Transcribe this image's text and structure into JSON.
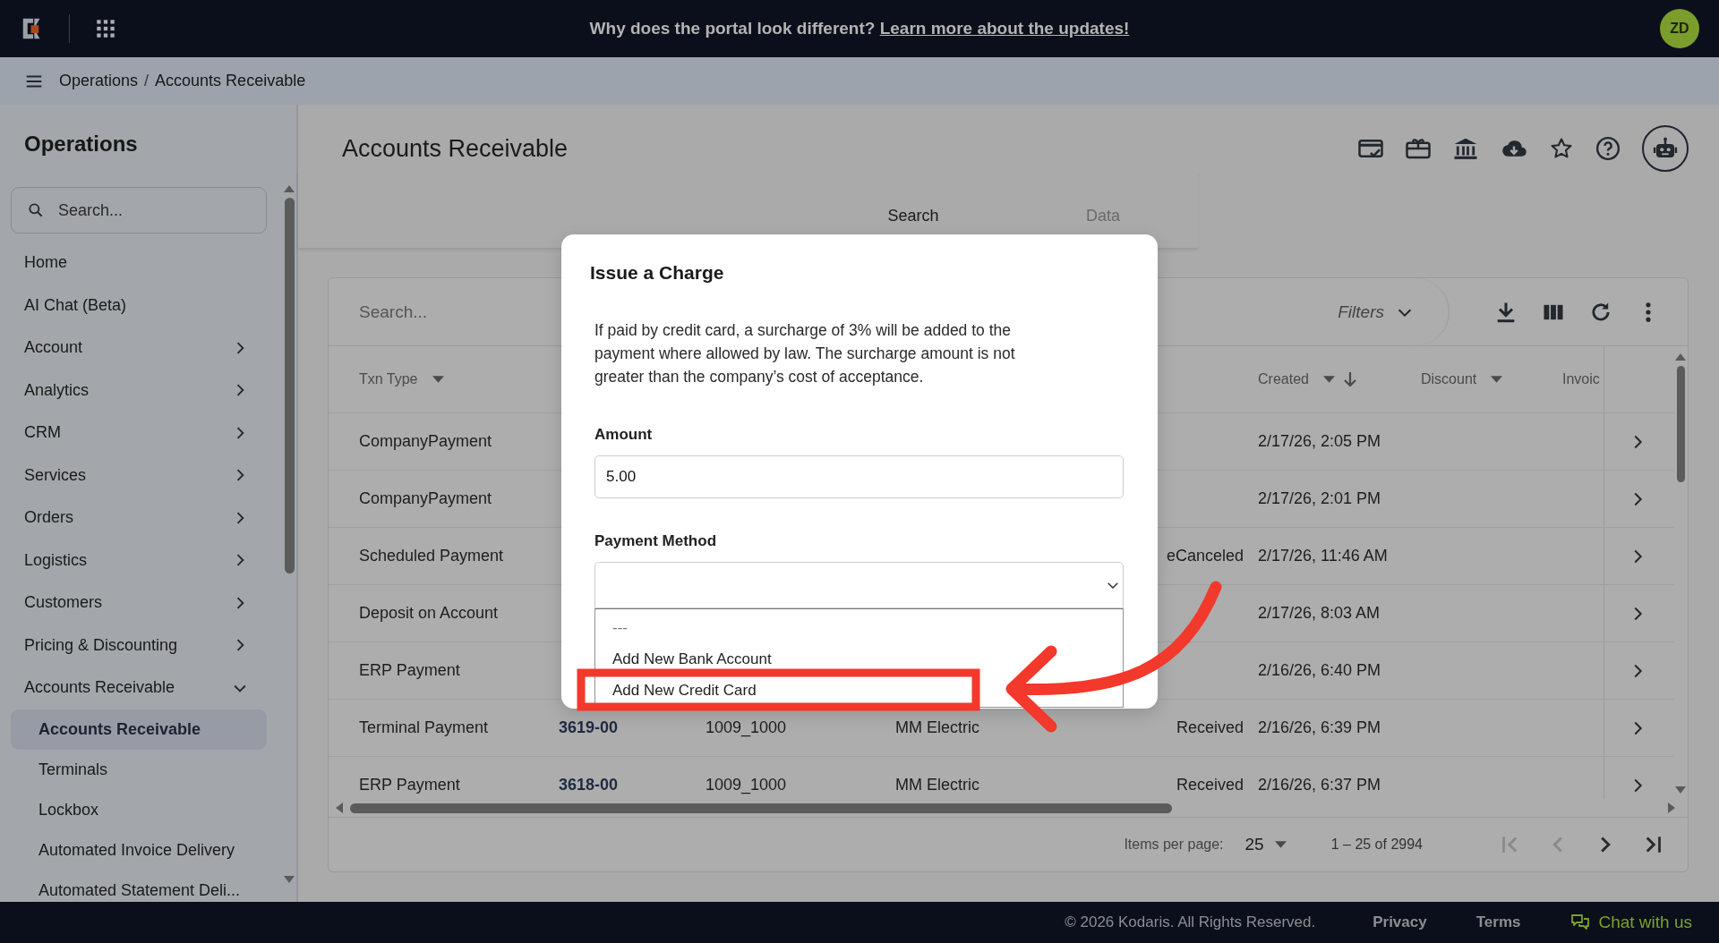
{
  "top_bar": {
    "banner_text": "Why does the portal look different?",
    "banner_link": "Learn more about the updates!",
    "avatar": "ZD"
  },
  "breadcrumb": {
    "items": [
      "Operations",
      "Accounts Receivable"
    ],
    "separator": "/"
  },
  "sidebar": {
    "title": "Operations",
    "search": {
      "placeholder": "Search..."
    },
    "items": [
      {
        "label": "Home",
        "kind": "link"
      },
      {
        "label": "AI Chat (Beta)",
        "kind": "link"
      },
      {
        "label": "Account",
        "kind": "group",
        "expanded": false
      },
      {
        "label": "Analytics",
        "kind": "group",
        "expanded": false
      },
      {
        "label": "CRM",
        "kind": "group",
        "expanded": false
      },
      {
        "label": "Services",
        "kind": "group",
        "expanded": false
      },
      {
        "label": "Orders",
        "kind": "group",
        "expanded": false
      },
      {
        "label": "Logistics",
        "kind": "group",
        "expanded": false
      },
      {
        "label": "Customers",
        "kind": "group",
        "expanded": false
      },
      {
        "label": "Pricing & Discounting",
        "kind": "group",
        "expanded": false
      },
      {
        "label": "Accounts Receivable",
        "kind": "group",
        "expanded": true,
        "children": [
          {
            "label": "Accounts Receivable",
            "selected": true
          },
          {
            "label": "Terminals",
            "selected": false
          },
          {
            "label": "Lockbox",
            "selected": false
          },
          {
            "label": "Automated Invoice Delivery",
            "selected": false
          },
          {
            "label": "Automated Statement Deli...",
            "selected": false
          }
        ]
      }
    ]
  },
  "page": {
    "title": "Accounts Receivable",
    "tabs": [
      {
        "label": "Search",
        "selected": true
      },
      {
        "label": "Data",
        "selected": false
      }
    ]
  },
  "table": {
    "search": {
      "placeholder": "Search..."
    },
    "filters_label": "Filters",
    "columns": [
      {
        "kind": "filter",
        "label": "Txn Type"
      },
      {
        "kind": "covered"
      },
      {
        "kind": "covered"
      },
      {
        "kind": "covered"
      },
      {
        "kind": "covered"
      },
      {
        "kind": "filter_sorted",
        "label": "Created"
      },
      {
        "kind": "filter",
        "label": "Discount"
      },
      {
        "kind": "plain",
        "label": "Invoic"
      }
    ],
    "rows": [
      {
        "txn_type": "CompanyPayment",
        "created": "2/17/26, 2:05 PM"
      },
      {
        "txn_type": "CompanyPayment",
        "created": "2/17/26, 2:01 PM"
      },
      {
        "txn_type": "Scheduled Payment",
        "column_5": "eCanceled",
        "created": "2/17/26, 11:46 AM"
      },
      {
        "txn_type": "Deposit on Account",
        "created": "2/17/26, 8:03 AM"
      },
      {
        "txn_type": "ERP Payment",
        "created": "2/16/26, 6:40 PM"
      },
      {
        "txn_type": "Terminal Payment",
        "column_2": "3619-00",
        "column_3": "1009_1000",
        "column_4": "MM Electric",
        "column_5": "Received",
        "created": "2/16/26, 6:39 PM"
      },
      {
        "txn_type": "ERP Payment",
        "column_2": "3618-00",
        "column_3": "1009_1000",
        "column_4": "MM Electric",
        "column_5": "Received",
        "created": "2/16/26, 6:37 PM"
      }
    ],
    "paginator": {
      "items_per_page_label": "Items per page:",
      "page_size": "25",
      "range": "1 – 25 of 2994",
      "buttons": [
        {
          "kind": "first",
          "disabled": true
        },
        {
          "kind": "prev",
          "disabled": true
        },
        {
          "kind": "next",
          "disabled": false
        },
        {
          "kind": "last",
          "disabled": false
        }
      ]
    }
  },
  "dialog": {
    "title": "Issue a Charge",
    "notice": "If paid by credit card, a surcharge of 3% will be added to the payment where allowed by law. The surcharge amount is not greater than the company’s cost of acceptance.",
    "amount": {
      "label": "Amount",
      "value": "5.00"
    },
    "payment_method": {
      "label": "Payment Method",
      "open": true,
      "options": [
        {
          "label": "---",
          "kind": "placeholder",
          "selected": false
        },
        {
          "label": "Add New Bank Account",
          "kind": "option",
          "selected": false
        },
        {
          "label": "Add New Credit Card",
          "kind": "option",
          "selected": false
        }
      ]
    }
  },
  "footer": {
    "copyright": "© 2026 Kodaris. All Rights Reserved.",
    "links": [
      "Privacy",
      "Terms"
    ],
    "chat": "Chat with us"
  }
}
